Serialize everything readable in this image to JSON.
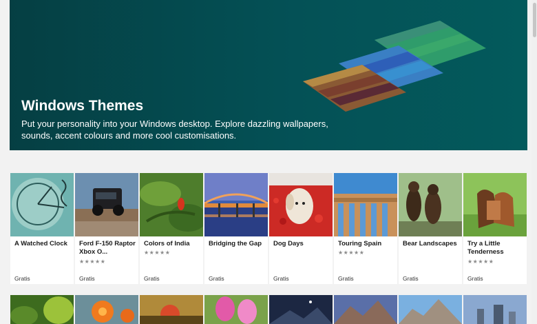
{
  "hero": {
    "title": "Windows Themes",
    "description": "Put your personality into your Windows desktop. Explore dazzling wallpapers, sounds, accent colours and more cool customisations."
  },
  "themes": [
    {
      "title": "A Watched Clock",
      "rating": "",
      "price": "Gratis"
    },
    {
      "title": "Ford F-150 Raptor Xbox O...",
      "rating": "★★★★★",
      "price": "Gratis"
    },
    {
      "title": "Colors of India",
      "rating": "★★★★★",
      "price": "Gratis"
    },
    {
      "title": "Bridging the Gap",
      "rating": "",
      "price": "Gratis"
    },
    {
      "title": "Dog Days",
      "rating": "",
      "price": "Gratis"
    },
    {
      "title": "Touring Spain",
      "rating": "★★★★★",
      "price": "Gratis"
    },
    {
      "title": "Bear Landscapes",
      "rating": "",
      "price": "Gratis"
    },
    {
      "title": "Try a Little Tenderness",
      "rating": "★★★★★",
      "price": "Gratis"
    }
  ]
}
